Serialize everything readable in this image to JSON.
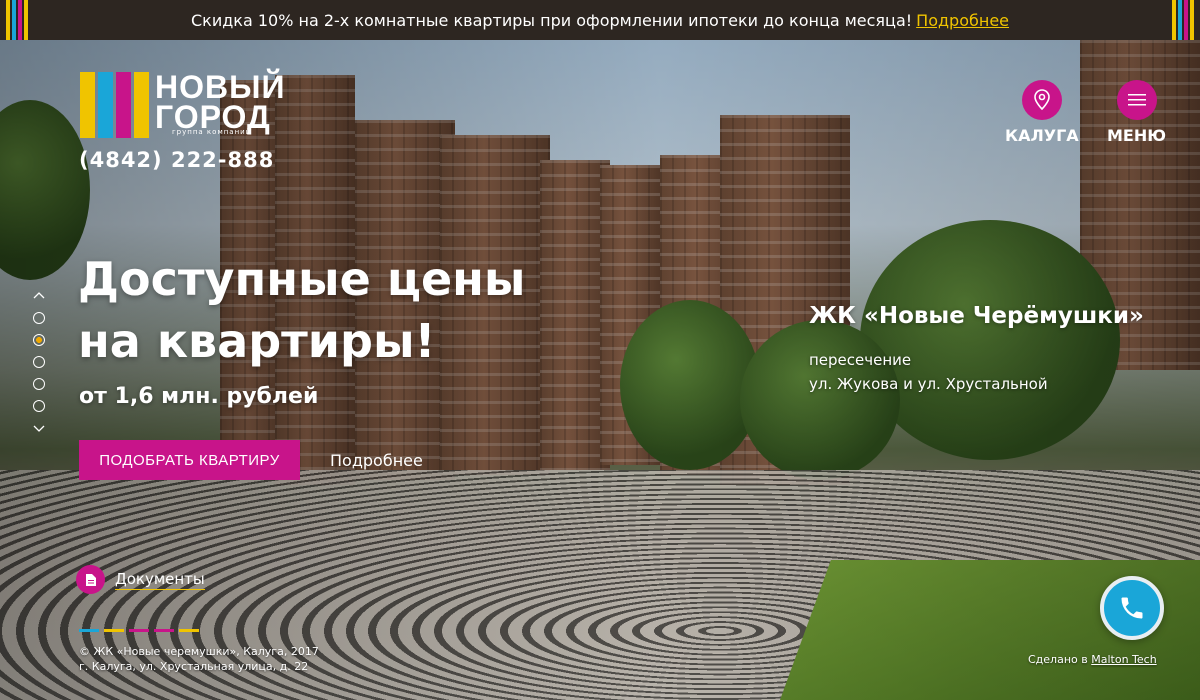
{
  "colors": {
    "accent": "#c8148a",
    "promo_bg": "#2d2621",
    "link_yellow": "#f0c400",
    "call_blue": "#1aa6d8",
    "stripe_colors": [
      "#f0c400",
      "#1aa6d8",
      "#c8148a",
      "#f0c400"
    ]
  },
  "promo": {
    "text": "Скидка 10% на 2-х комнатные квартиры при оформлении ипотеки до конца месяца!",
    "link": "Подробнее"
  },
  "logo": {
    "line1": "НОВЫЙ",
    "line2": "ГОРОД",
    "tagline": "группа компаний"
  },
  "phone": "(4842) 222-888",
  "nav": {
    "city_label": "КАЛУГА",
    "city_icon": "location-pin-icon",
    "menu_label": "МЕНЮ",
    "menu_icon": "hamburger-icon"
  },
  "slider": {
    "slide_count": 5,
    "active_index": 2
  },
  "hero": {
    "headline_line1": "Доступные цены",
    "headline_line2": "на квартиры!",
    "price": "от 1,6 млн. рублей",
    "cta": "ПОДОБРАТЬ КВАРТИРУ",
    "more": "Подробнее"
  },
  "complex": {
    "name": "ЖК «Новые Черёмушки»",
    "addr_line1": "пересечение",
    "addr_line2": "ул. Жукова и ул. Хрустальной"
  },
  "documents": {
    "label": "Документы",
    "icon": "document-icon"
  },
  "footer": {
    "copyright": "© ЖК «Новые черемушки», Калуга, 2017",
    "address": "г. Калуга, ул. Хрустальная улица, д. 22",
    "credit_prefix": "Сделано в",
    "credit_link": "Malton Tech"
  },
  "call_icon": "phone-icon"
}
